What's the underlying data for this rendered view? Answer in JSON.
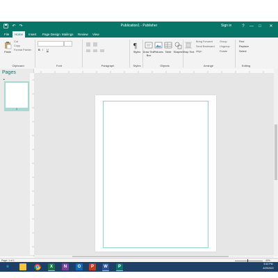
{
  "colors": {
    "accent": "#077568",
    "taskbar": "#1e3f66"
  },
  "window": {
    "title": "Publication1 - Publisher",
    "sign_in": "Sign in",
    "help": "?",
    "ribbon_display": "▭",
    "minimize": "—",
    "maximize": "□",
    "close": "✕"
  },
  "qat": {
    "save_icon": "save-icon",
    "undo": "↶",
    "redo": "↷"
  },
  "tabs": [
    "File",
    "Home",
    "Insert",
    "Page Design",
    "Mailings",
    "Review",
    "View"
  ],
  "ribbon": {
    "clipboard": {
      "paste": "Paste",
      "cut": "Cut",
      "copy": "Copy",
      "format_painter": "Format Painter",
      "label": "Clipboard"
    },
    "font": {
      "label": "Font",
      "bold": "B",
      "italic": "I",
      "underline": "U"
    },
    "paragraph": {
      "label": "Paragraph"
    },
    "styles": {
      "button": "Styles",
      "label": "Styles"
    },
    "objects": {
      "draw_text_box": "Draw Text Box",
      "pictures": "Pictures",
      "table": "Table",
      "shapes": "Shapes",
      "label": "Objects"
    },
    "arrange": {
      "wrap_text": "Wrap Text",
      "bring_forward": "Bring Forward",
      "send_backward": "Send Backward",
      "align": "Align",
      "group": "Group",
      "ungroup": "Ungroup",
      "rotate": "Rotate",
      "label": "Arrange"
    },
    "editing": {
      "find": "Find",
      "replace": "Replace",
      "select": "Select",
      "label": "Editing"
    }
  },
  "pages_pane": {
    "title": "Pages",
    "thumb_number": "1"
  },
  "status": {
    "page": "Page: 1 of 1",
    "zoom": "40%"
  },
  "taskbar": {
    "apps": [
      "ie-icon",
      "explorer-icon",
      "chrome-icon",
      "excel-icon",
      "onenote-icon",
      "outlook-icon",
      "powerpoint-icon",
      "word-icon",
      "publisher-icon"
    ],
    "time": "5:40 PM",
    "date": "4/29/2022"
  }
}
